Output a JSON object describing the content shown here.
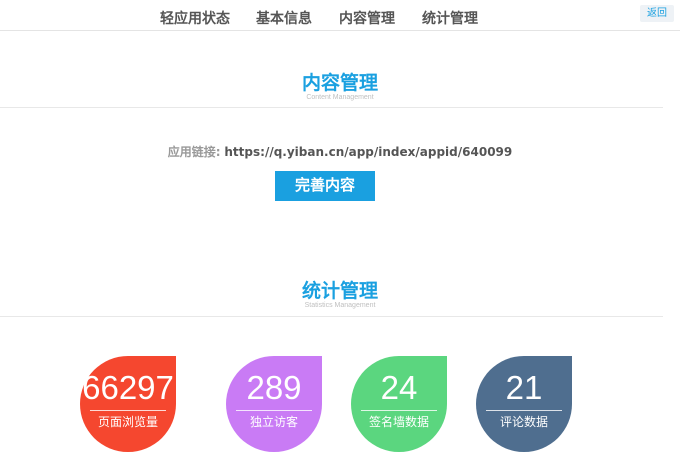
{
  "nav": {
    "tabs": [
      {
        "label": "轻应用状态"
      },
      {
        "label": "基本信息"
      },
      {
        "label": "内容管理"
      },
      {
        "label": "统计管理"
      }
    ],
    "back_label": "返回"
  },
  "content_section": {
    "title": "内容管理",
    "subtitle": "Content Management",
    "link_label": "应用链接:",
    "link_url": "https://q.yiban.cn/app/index/appid/640099",
    "button_label": "完善内容"
  },
  "stats_section": {
    "title": "统计管理",
    "subtitle": "Statistics Management",
    "stats": [
      {
        "value": "66297",
        "label": "页面浏览量",
        "color": "#f5472f"
      },
      {
        "value": "289",
        "label": "独立访客",
        "color": "#c97bf5"
      },
      {
        "value": "24",
        "label": "签名墙数据",
        "color": "#5bd67f"
      },
      {
        "value": "21",
        "label": "评论数据",
        "color": "#4f6e8f"
      }
    ]
  }
}
